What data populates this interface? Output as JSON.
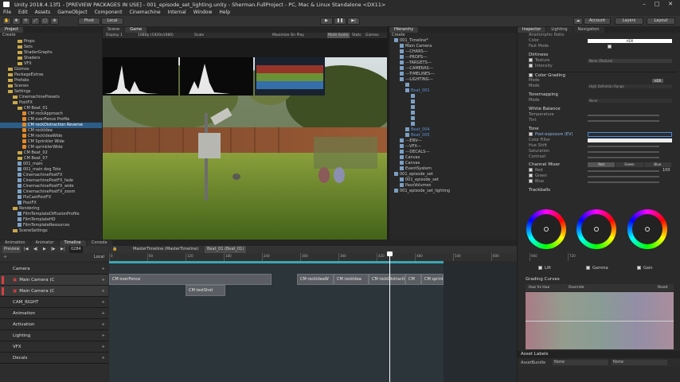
{
  "window": {
    "title": "Unity 2018.4.13f1 - [PREVIEW PACKAGES IN USE] - 001_episode_set_lighting.unity - Sherman.FullProject - PC, Mac & Linux Standalone <DX11>"
  },
  "menu": [
    "File",
    "Edit",
    "Assets",
    "GameObject",
    "Component",
    "Cinemachine",
    "Internal",
    "Window",
    "Help"
  ],
  "toolbar": {
    "pivot": "Pivot",
    "local": "Local",
    "account": "Account",
    "layers": "Layers",
    "layout": "Layout",
    "play": "▶",
    "pause": "❚❚",
    "step": "▶|"
  },
  "project": {
    "tab": "Project",
    "create": "Create",
    "items": [
      {
        "label": "Props",
        "kind": "folder",
        "indent": 3
      },
      {
        "label": "Sets",
        "kind": "folder",
        "indent": 3
      },
      {
        "label": "ShaderGraphs",
        "kind": "folder",
        "indent": 3
      },
      {
        "label": "Shaders",
        "kind": "folder",
        "indent": 3
      },
      {
        "label": "VFX",
        "kind": "folder",
        "indent": 3
      },
      {
        "label": "Gizmos",
        "kind": "folder",
        "indent": 1
      },
      {
        "label": "PackageExtras",
        "kind": "folder",
        "indent": 1
      },
      {
        "label": "Prefabs",
        "kind": "folder",
        "indent": 1
      },
      {
        "label": "Scenes",
        "kind": "folder",
        "indent": 1
      },
      {
        "label": "Settings",
        "kind": "folder",
        "indent": 1
      },
      {
        "label": "CinemachinePresets",
        "kind": "folder",
        "indent": 2
      },
      {
        "label": "PostFX",
        "kind": "folder",
        "indent": 2
      },
      {
        "label": "CM Beat_01",
        "kind": "folder",
        "indent": 3
      },
      {
        "label": "CM rockApproach",
        "kind": "cm",
        "indent": 4
      },
      {
        "label": "CM overFence Profile",
        "kind": "cm",
        "indent": 4
      },
      {
        "label": "CM rockDistraction Reverse",
        "kind": "cm",
        "indent": 4,
        "selected": true
      },
      {
        "label": "CM rockIdea",
        "kind": "cm",
        "indent": 4
      },
      {
        "label": "CM rockIdeaWide",
        "kind": "cm",
        "indent": 4
      },
      {
        "label": "CM Sprinkler Wide",
        "kind": "cm",
        "indent": 4
      },
      {
        "label": "CM sprinklerWide",
        "kind": "cm",
        "indent": 4
      },
      {
        "label": "CM Beat_02",
        "kind": "folder",
        "indent": 3
      },
      {
        "label": "CM Beat_07",
        "kind": "folder",
        "indent": 3
      },
      {
        "label": "001_main",
        "kind": "go",
        "indent": 3
      },
      {
        "label": "001_main dog Toto",
        "kind": "go",
        "indent": 3
      },
      {
        "label": "CinemachinePostFX",
        "kind": "go",
        "indent": 3
      },
      {
        "label": "CinemachinePostFX_fade",
        "kind": "go",
        "indent": 3
      },
      {
        "label": "CinemachinePostFX_wide",
        "kind": "go",
        "indent": 3
      },
      {
        "label": "CinemachinePostFX_zoom",
        "kind": "go",
        "indent": 3
      },
      {
        "label": "PixCastPostFX",
        "kind": "go",
        "indent": 3
      },
      {
        "label": "PostFX",
        "kind": "go",
        "indent": 3
      },
      {
        "label": "Rendering",
        "kind": "folder",
        "indent": 2
      },
      {
        "label": "FilmTemplateDiffusionProfile",
        "kind": "go",
        "indent": 3
      },
      {
        "label": "FilmTemplateHD",
        "kind": "go",
        "indent": 3
      },
      {
        "label": "FilmTemplateResources",
        "kind": "go",
        "indent": 3
      },
      {
        "label": "SceneSettings",
        "kind": "folder",
        "indent": 2
      }
    ]
  },
  "views": {
    "scene_tab": "Scene",
    "game_tab": "Game",
    "display": "Display 1",
    "resolution": "1080p (1920x1080)",
    "scale": "Scale",
    "maximize": "Maximize On Play",
    "mute": "Mute Audio",
    "stats": "Stats",
    "gizmos": "Gizmos"
  },
  "hierarchy": {
    "tab": "Hierarchy",
    "create": "Create",
    "items": [
      {
        "label": "001_Timeline*",
        "indent": 0
      },
      {
        "label": "Main Camera",
        "indent": 1
      },
      {
        "label": "---CHARS---",
        "indent": 1
      },
      {
        "label": "---PROPS---",
        "indent": 1
      },
      {
        "label": "---TARGETS---",
        "indent": 1
      },
      {
        "label": "---CAMERAS---",
        "indent": 1
      },
      {
        "label": "---TIMELINES---",
        "indent": 1
      },
      {
        "label": "---LIGHTING---",
        "indent": 1
      },
      {
        "label": "",
        "indent": 2
      },
      {
        "label": "Beat_001",
        "indent": 2
      },
      {
        "label": "",
        "indent": 3
      },
      {
        "label": "",
        "indent": 3
      },
      {
        "label": "",
        "indent": 3
      },
      {
        "label": "",
        "indent": 3
      },
      {
        "label": "",
        "indent": 3
      },
      {
        "label": "",
        "indent": 3
      },
      {
        "label": "Beat_004",
        "indent": 2
      },
      {
        "label": "Beat_005",
        "indent": 2
      },
      {
        "label": "---ENV---",
        "indent": 1
      },
      {
        "label": "---VFX---",
        "indent": 1
      },
      {
        "label": "---DECALS---",
        "indent": 1
      },
      {
        "label": "Canvas",
        "indent": 1
      },
      {
        "label": "Canvas",
        "indent": 1
      },
      {
        "label": "EventSystem",
        "indent": 1
      },
      {
        "label": "001_episode_set",
        "indent": 0
      },
      {
        "label": "001_episode_set",
        "indent": 1
      },
      {
        "label": "PassVolumes",
        "indent": 1
      },
      {
        "label": "001_episode_set_lighting",
        "indent": 0
      }
    ]
  },
  "inspector": {
    "tabs": [
      "Inspector",
      "Lighting",
      "Navigation"
    ],
    "top_fields": [
      {
        "label": "Anamorphic Ratio"
      },
      {
        "label": "Color",
        "value": "HDR"
      },
      {
        "label": "Fast Mode",
        "checked": true
      }
    ],
    "dirtiness": "Dirtiness",
    "texture": {
      "label": "Texture",
      "value": "None (Texture)"
    },
    "intensity": {
      "label": "Intensity"
    },
    "color_grading": "Color Grading",
    "mode_label": "HDR",
    "mode_btn": "Mode",
    "lut_label": "Mode",
    "lut_value": "High Definition Range",
    "tonemapping": "Tonemapping",
    "tonemap_mode": "Mode",
    "tonemap_value": "None",
    "white_balance": "White Balance",
    "temperature": "Temperature",
    "tint": "Tint",
    "tone": "Tone",
    "post_exposure": "Post-exposure (EV)",
    "color_filter": "Color Filter",
    "hue_shift": "Hue Shift",
    "saturation": "Saturation",
    "contrast": "Contrast",
    "channel_mixer": "Channel Mixer",
    "mixer_tabs": [
      "Red",
      "Green",
      "Blue"
    ],
    "red": "Red",
    "green": "Green",
    "blue": "Blue",
    "red_val": "100",
    "trackballs": "Trackballs",
    "lift": "Lift",
    "gamma": "Gamma",
    "gain": "Gain",
    "grading_curves": "Grading Curves",
    "hue_vs_hue": "Hue Vs Hue",
    "override": "Override",
    "reset": "Reset",
    "asset_labels": "Asset Labels",
    "asset_bundle": "AssetBundle",
    "asset_bundle_value": "None",
    "asset_bundle_value2": "None"
  },
  "timeline": {
    "tabs": [
      "Animation",
      "Animator",
      "Timeline",
      "Console"
    ],
    "preview": "Preview",
    "frame": "0284",
    "local": "Local",
    "breadcrumb": "MasterTimeline (MasterTimeline)",
    "breadcrumb2": "Beat_01 (Beat_01)",
    "ruler": [
      "0",
      "60",
      "120",
      "180",
      "240",
      "300",
      "360",
      "420",
      "480",
      "540",
      "600",
      "660",
      "720"
    ],
    "tracks": [
      {
        "label": "Camera",
        "type": "group"
      },
      {
        "label": "Main Camera (C",
        "type": "cam"
      },
      {
        "label": "Main Camera (C",
        "type": "cam"
      },
      {
        "label": "CAM_RIGHT",
        "type": "group"
      },
      {
        "label": "Animation",
        "type": "group"
      },
      {
        "label": "Activation",
        "type": "group"
      },
      {
        "label": "Lighting",
        "type": "group"
      },
      {
        "label": "VFX",
        "type": "group"
      },
      {
        "label": "Decals",
        "type": "group"
      }
    ],
    "clips": [
      {
        "label": "CM overFence",
        "start": 0,
        "end": 204
      },
      {
        "label": "CM rockIdeaW",
        "start": 236,
        "end": 282
      },
      {
        "label": "CM rockIdea",
        "start": 282,
        "end": 326
      },
      {
        "label": "CM rockDistraction",
        "start": 326,
        "end": 372
      },
      {
        "label": "CM",
        "start": 372,
        "end": 392
      },
      {
        "label": "CM sprink",
        "start": 392,
        "end": 420
      }
    ],
    "clip2": {
      "label": "CM testShot",
      "start": 96,
      "end": 146
    }
  }
}
